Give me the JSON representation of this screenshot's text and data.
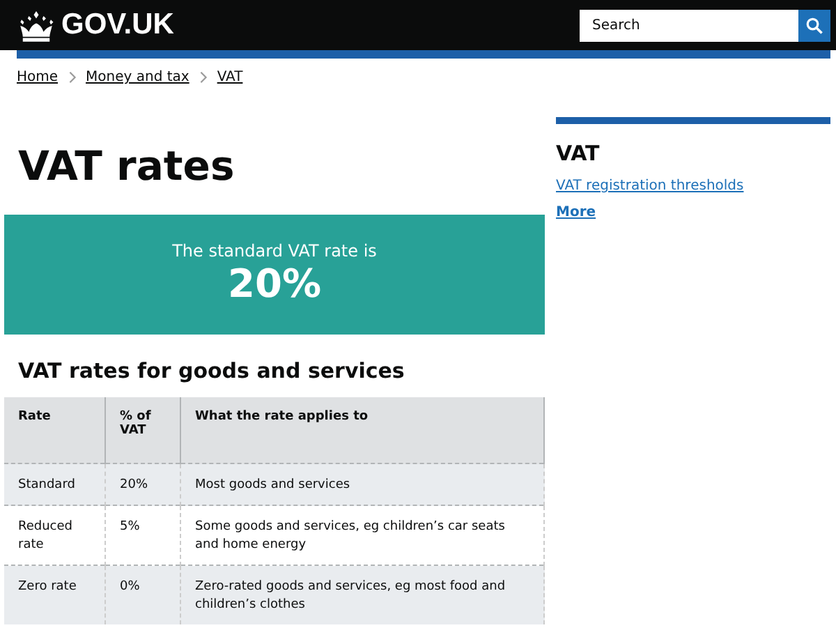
{
  "header": {
    "logo": "GOV.UK",
    "search": {
      "placeholder": "Search"
    }
  },
  "breadcrumbs": [
    "Home",
    "Money and tax",
    "VAT"
  ],
  "title": "VAT rates",
  "highlight": {
    "intro": "The standard VAT rate is",
    "value": "20%"
  },
  "section_title": "VAT rates for goods and services",
  "table": {
    "columns": [
      "Rate",
      "% of VAT",
      "What the rate applies to"
    ],
    "rows": [
      [
        "Standard",
        "20%",
        "Most goods and services"
      ],
      [
        "Reduced rate",
        "5%",
        "Some goods and services, eg children’s car seats and home energy"
      ],
      [
        "Zero rate",
        "0%",
        "Zero-rated goods and services, eg most food and children’s clothes"
      ]
    ]
  },
  "sidebar": {
    "title": "VAT",
    "links": [
      "VAT registration thresholds",
      "More"
    ]
  }
}
